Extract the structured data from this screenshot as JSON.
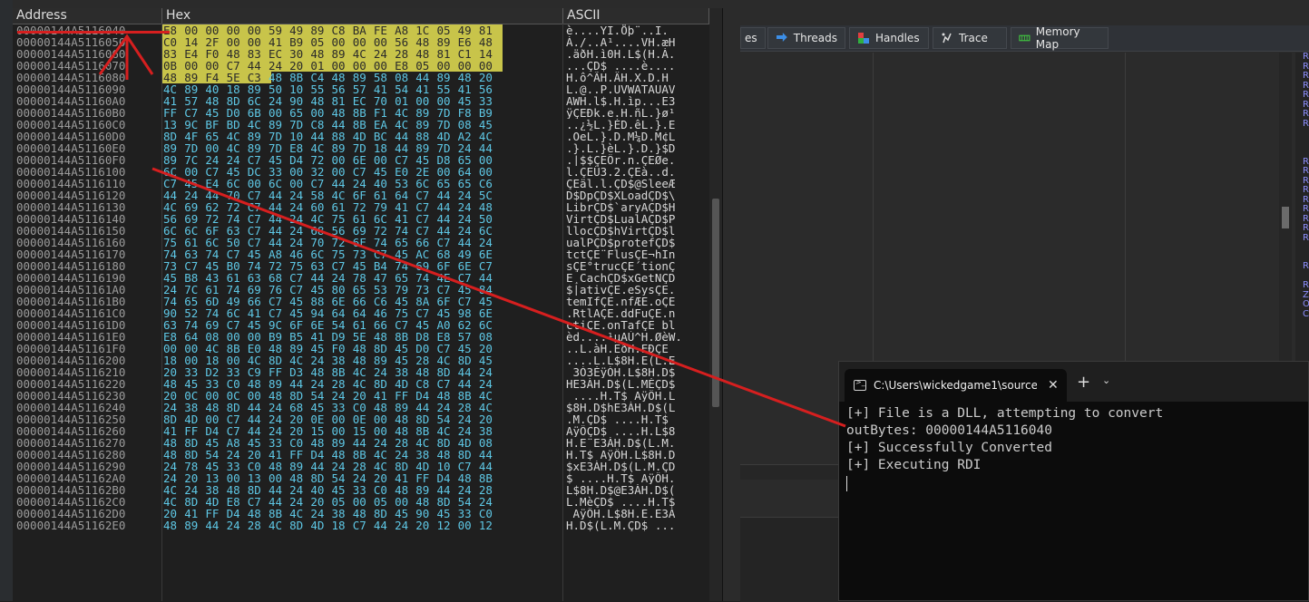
{
  "tabs": [
    {
      "label": "es",
      "icon": "none"
    },
    {
      "label": "Threads",
      "icon": "threads-icon"
    },
    {
      "label": "Handles",
      "icon": "handles-icon"
    },
    {
      "label": "Trace",
      "icon": "trace-icon"
    },
    {
      "label": "Memory Map",
      "icon": "memory-map-icon"
    }
  ],
  "dump": {
    "headers": {
      "address": "Address",
      "hex": "Hex",
      "ascii": "ASCII"
    },
    "highlight_color": "#c8c44a",
    "rows": [
      {
        "addr": "00000144A5116040",
        "hex": "E8 00 00 00 00 59 49 89 C8 BA FE A8 1C 05 49 81",
        "ascii": "è....YI.Ȫþ¨..I.",
        "hl": 16
      },
      {
        "addr": "00000144A5116050",
        "hex": "C0 14 2F 00 00 41 B9 05 00 00 00 56 48 89 E6 48",
        "ascii": "À./..A¹....VH.æH",
        "hl": 16
      },
      {
        "addr": "00000144A5116060",
        "hex": "83 E4 F0 48 83 EC 30 48 89 4C 24 28 48 81 C1 14",
        "ascii": ".äðH.ì0H.L$(H.Á.",
        "hl": 16
      },
      {
        "addr": "00000144A5116070",
        "hex": "0B 00 00 C7 44 24 20 01 00 00 00 E8 05 00 00 00",
        "ascii": "...ÇD$ ....è....",
        "hl": 16
      },
      {
        "addr": "00000144A5116080",
        "hex": "48 89 F4 5E C3 48 8B C4 48 89 58 08 44 89 48 20",
        "ascii": "H.ô^ÃH.ÄH.X.D.H ",
        "hl": 5
      },
      {
        "addr": "00000144A5116090",
        "hex": "4C 89 40 18 89 50 10 55 56 57 41 54 41 55 41 56",
        "ascii": "L.@..P.UVWATAUAV",
        "hl": 0
      },
      {
        "addr": "00000144A51160A0",
        "hex": "41 57 48 8D 6C 24 90 48 81 EC 70 01 00 00 45 33",
        "ascii": "AWH.l$.H.ìp...E3",
        "hl": 0
      },
      {
        "addr": "00000144A51160B0",
        "hex": "FF C7 45 D0 6B 00 65 00 48 8B F1 4C 89 7D F8 B9",
        "ascii": "ÿÇEÐk.e.H.ñL.}ø¹",
        "hl": 0
      },
      {
        "addr": "00000144A51160C0",
        "hex": "13 9C BF BD 4C 89 7D C8 44 8B EA 4C 89 7D 08 45",
        "ascii": "..¿½L.}ÈD.êL.}.E",
        "hl": 0
      },
      {
        "addr": "00000144A51160D0",
        "hex": "8D 4F 65 4C 89 7D 10 44 88 4D BC 44 88 4D A2 4C",
        "ascii": ".OeL.}.D.M¼D.M¢L",
        "hl": 0
      },
      {
        "addr": "00000144A51160E0",
        "hex": "89 7D 00 4C 89 7D E8 4C 89 7D 18 44 89 7D 24 44",
        "ascii": ".}.L.}èL.}.D.}$D",
        "hl": 0
      },
      {
        "addr": "00000144A51160F0",
        "hex": "89 7C 24 24 C7 45 D4 72 00 6E 00 C7 45 D8 65 00",
        "ascii": ".|$$ÇEÔr.n.ÇEØe.",
        "hl": 0
      },
      {
        "addr": "00000144A5116100",
        "hex": "6C 00 C7 45 DC 33 00 32 00 C7 45 E0 2E 00 64 00",
        "ascii": "l.ÇEÜ3.2.ÇEà..d.",
        "hl": 0
      },
      {
        "addr": "00000144A5116110",
        "hex": "C7 45 E4 6C 00 6C 00 C7 44 24 40 53 6C 65 65 C6",
        "ascii": "ÇEäl.l.ÇD$@SleeÆ",
        "hl": 0
      },
      {
        "addr": "00000144A5116120",
        "hex": "44 24 44 70 C7 44 24 58 4C 6F 61 64 C7 44 24 5C",
        "ascii": "D$DpÇD$XLoadÇD$\\",
        "hl": 0
      },
      {
        "addr": "00000144A5116130",
        "hex": "4C 69 62 72 C7 44 24 60 61 72 79 41 C7 44 24 48",
        "ascii": "LibrÇD$`aryAÇD$H",
        "hl": 0
      },
      {
        "addr": "00000144A5116140",
        "hex": "56 69 72 74 C7 44 24 4C 75 61 6C 41 C7 44 24 50",
        "ascii": "VirtÇD$LualAÇD$P",
        "hl": 0
      },
      {
        "addr": "00000144A5116150",
        "hex": "6C 6C 6F 63 C7 44 24 68 56 69 72 74 C7 44 24 6C",
        "ascii": "llocÇD$hVirtÇD$l",
        "hl": 0
      },
      {
        "addr": "00000144A5116160",
        "hex": "75 61 6C 50 C7 44 24 70 72 6F 74 65 66 C7 44 24",
        "ascii": "ualPÇD$protefÇD$",
        "hl": 0
      },
      {
        "addr": "00000144A5116170",
        "hex": "74 63 74 C7 45 A8 46 6C 75 73 C7 45 AC 68 49 6E",
        "ascii": "tctÇE¨FlusÇE¬hIn",
        "hl": 0
      },
      {
        "addr": "00000144A5116180",
        "hex": "73 C7 45 B0 74 72 75 63 C7 45 B4 74 69 6F 6E C7",
        "ascii": "sÇE°trucÇE´tionÇ",
        "hl": 0
      },
      {
        "addr": "00000144A5116190",
        "hex": "45 B8 43 61 63 68 C7 44 24 78 47 65 74 4E C7 44",
        "ascii": "E¸CachÇD$xGetNÇD",
        "hl": 0
      },
      {
        "addr": "00000144A51161A0",
        "hex": "24 7C 61 74 69 76 C7 45 80 65 53 79 73 C7 45 84",
        "ascii": "$|ativÇE.eSysÇE.",
        "hl": 0
      },
      {
        "addr": "00000144A51161B0",
        "hex": "74 65 6D 49 66 C7 45 88 6E 66 C6 45 8A 6F C7 45",
        "ascii": "temIfÇE.nfÆE.oÇE",
        "hl": 0
      },
      {
        "addr": "00000144A51161C0",
        "hex": "90 52 74 6C 41 C7 45 94 64 64 46 75 C7 45 98 6E",
        "ascii": ".RtlAÇE.ddFuÇE.n",
        "hl": 0
      },
      {
        "addr": "00000144A51161D0",
        "hex": "63 74 69 C7 45 9C 6F 6E 54 61 66 C7 45 A0 62 6C",
        "ascii": "ctiÇE.onTafÇE bl",
        "hl": 0
      },
      {
        "addr": "00000144A51161E0",
        "hex": "E8 64 08 00 00 B9 B5 41 D9 5E 48 8B D8 E8 57 08",
        "ascii": "èd....¹µAÙ^H.ØèW.",
        "hl": 0
      },
      {
        "addr": "00000144A51161F0",
        "hex": "00 00 4C 8B E0 48 89 45 F0 48 8D 45 D0 C7 45 20",
        "ascii": "..L.àH.EðH.EÐÇE ",
        "hl": 0
      },
      {
        "addr": "00000144A5116200",
        "hex": "18 00 18 00 4C 8D 4C 24 38 48 89 45 28 4C 8D 45",
        "ascii": "....L.L$8H.E(L.E",
        "hl": 0
      },
      {
        "addr": "00000144A5116210",
        "hex": "20 33 D2 33 C9 FF D3 48 8B 4C 24 38 48 8D 44 24",
        "ascii": " 3Ò3ÉÿÓH.L$8H.D$",
        "hl": 0
      },
      {
        "addr": "00000144A5116220",
        "hex": "48 45 33 C0 48 89 44 24 28 4C 8D 4D C8 C7 44 24",
        "ascii": "HE3ÀH.D$(L.MÈÇD$",
        "hl": 0
      },
      {
        "addr": "00000144A5116230",
        "hex": "20 0C 00 0C 00 48 8D 54 24 20 41 FF D4 48 8B 4C",
        "ascii": " ....H.T$ AÿÔH.L",
        "hl": 0
      },
      {
        "addr": "00000144A5116240",
        "hex": "24 38 48 8D 44 24 68 45 33 C0 48 89 44 24 28 4C",
        "ascii": "$8H.D$hE3ÀH.D$(L",
        "hl": 0
      },
      {
        "addr": "00000144A5116250",
        "hex": "8D 4D 00 C7 44 24 20 0E 00 0E 00 48 8D 54 24 20",
        "ascii": ".M.ÇD$ ....H.T$ ",
        "hl": 0
      },
      {
        "addr": "00000144A5116260",
        "hex": "41 FF D4 C7 44 24 20 15 00 15 00 48 8B 4C 24 38",
        "ascii": "AÿÔÇD$ ....H.L$8",
        "hl": 0
      },
      {
        "addr": "00000144A5116270",
        "hex": "48 8D 45 A8 45 33 C0 48 89 44 24 28 4C 8D 4D 08",
        "ascii": "H.E¨E3ÀH.D$(L.M.",
        "hl": 0
      },
      {
        "addr": "00000144A5116280",
        "hex": "48 8D 54 24 20 41 FF D4 48 8B 4C 24 38 48 8D 44",
        "ascii": "H.T$ AÿÔH.L$8H.D",
        "hl": 0
      },
      {
        "addr": "00000144A5116290",
        "hex": "24 78 45 33 C0 48 89 44 24 28 4C 8D 4D 10 C7 44",
        "ascii": "$xE3ÀH.D$(L.M.ÇD",
        "hl": 0
      },
      {
        "addr": "00000144A51162A0",
        "hex": "24 20 13 00 13 00 48 8D 54 24 20 41 FF D4 48 8B",
        "ascii": "$ ....H.T$ AÿÔH.",
        "hl": 0
      },
      {
        "addr": "00000144A51162B0",
        "hex": "4C 24 38 48 8D 44 24 40 45 33 C0 48 89 44 24 28",
        "ascii": "L$8H.D$@E3ÀH.D$(",
        "hl": 0
      },
      {
        "addr": "00000144A51162C0",
        "hex": "4C 8D 4D E8 C7 44 24 20 05 00 05 00 48 8D 54 24",
        "ascii": "L.MèÇD$ ....H.T$",
        "hl": 0
      },
      {
        "addr": "00000144A51162D0",
        "hex": "20 41 FF D4 48 8B 4C 24 38 48 8D 45 90 45 33 C0",
        "ascii": " AÿÔH.L$8H.E.E3À",
        "hl": 0
      },
      {
        "addr": "00000144A51162E0",
        "hex": "48 89 44 24 28 4C 8D 4D 18 C7 44 24 20 12 00 12",
        "ascii": "H.D$(L.M.ÇD$ ...",
        "hl": 0
      }
    ]
  },
  "terminal": {
    "tab_title": "C:\\Users\\wickedgame1\\source",
    "close": "✕",
    "new_tab": "+",
    "dropdown": "⌄",
    "lines": [
      "[+] File is a DLL, attempting to convert",
      "outBytes: 00000144A5116040",
      "[+] Successfully Converted",
      "[+] Executing RDI"
    ]
  },
  "right_column_letters": [
    "R",
    "R",
    "R",
    "R",
    "R",
    "R",
    "R",
    "R",
    "",
    "",
    "",
    "R",
    "R",
    "R",
    "R",
    "R",
    "R",
    "R",
    "R",
    "R",
    "",
    "",
    "R",
    "",
    "R",
    "Z",
    "O",
    "C"
  ],
  "colors": {
    "annotation_red": "#d61f1f",
    "hex_text": "#5ec8e6",
    "highlight": "#c8c44a"
  }
}
